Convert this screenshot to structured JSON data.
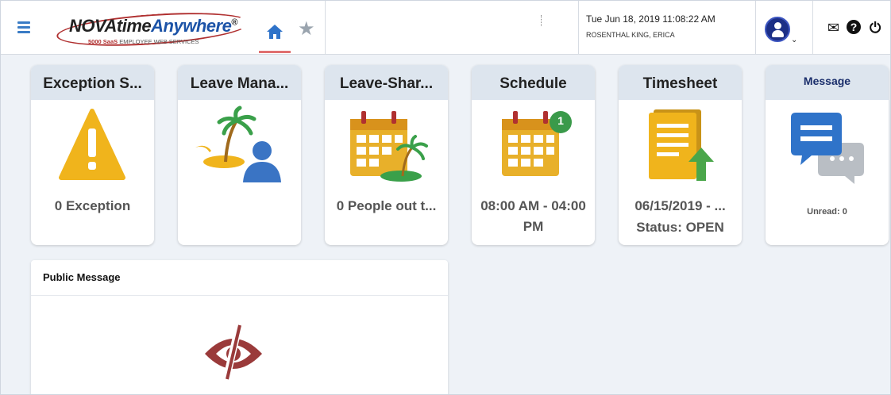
{
  "header": {
    "logo_brand_nova": "NOVAtime",
    "logo_brand_anywhere": "Anywhere",
    "logo_reg": "®",
    "logo_sub_bold": "5000 SaaS",
    "logo_sub": "EMPLOYEE WEB SERVICES",
    "datetime": "Tue Jun 18, 2019 11:08:22 AM",
    "username": "ROSENTHAL KING, ERICA",
    "star_glyph": "★",
    "mail_glyph": "✉",
    "help_glyph": "?",
    "power_glyph": "⏻",
    "caret_glyph": "⌄"
  },
  "tiles": [
    {
      "title": "Exception S...",
      "value": "0 Exception"
    },
    {
      "title": "Leave Mana...",
      "value": ""
    },
    {
      "title": "Leave-Shar...",
      "value": "0 People out t..."
    },
    {
      "title": "Schedule",
      "value": "08:00 AM - 04:00 PM",
      "badge": "1"
    },
    {
      "title": "Timesheet",
      "value": "06/15/2019 - ...",
      "value2": "Status: OPEN"
    },
    {
      "title": "Message",
      "value": "Unread:  0"
    }
  ],
  "public_message": {
    "title": "Public Message"
  },
  "colors": {
    "accent_blue": "#1c53a7",
    "tile_header": "#dde5ee",
    "warning_yellow": "#f0b41c",
    "calendar_orange": "#e8b02a",
    "badge_green": "#3a9a4a",
    "eye_red": "#9a3a3a"
  }
}
